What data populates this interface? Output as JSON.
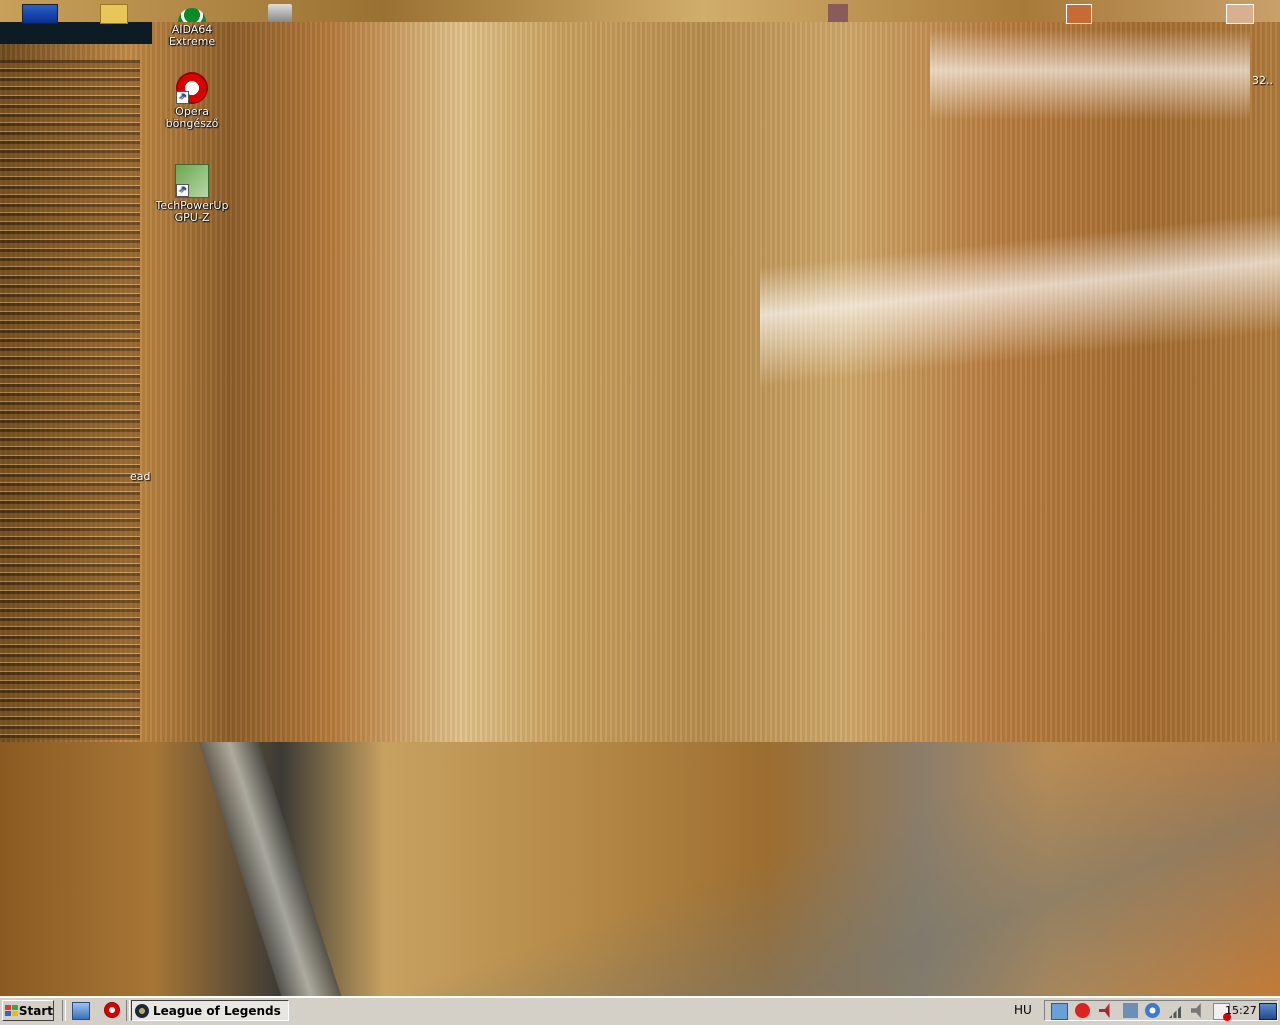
{
  "desktop": {
    "icons": [
      {
        "label_line1": "AIDA64",
        "label_line2": "Extreme",
        "icon": "aida64-icon"
      },
      {
        "label_line1": "Opera",
        "label_line2": "böngésző",
        "icon": "opera-icon"
      },
      {
        "label_line1": "TechPowerUp",
        "label_line2": "GPU-Z",
        "icon": "gpuz-icon"
      }
    ],
    "partial_labels": {
      "left_fragment": "ead",
      "right_fragment": "32.."
    }
  },
  "taskbar": {
    "start_label": "Start",
    "quick_launch": [
      "show-desktop-icon",
      "opera-icon"
    ],
    "tasks": [
      {
        "label": "League of Legends",
        "icon": "league-of-legends-icon",
        "active": true
      }
    ],
    "language": "HU",
    "tray_icons": [
      "info-icon",
      "antivirus-icon",
      "speaker-mute-icon",
      "network-icon",
      "update-icon",
      "signal-icon",
      "volume-icon",
      "security-alert-icon"
    ],
    "clock": "15:27"
  },
  "colors": {
    "taskbar_bg": "#d4d0c8",
    "wallpaper_tone": "#a9792f"
  }
}
